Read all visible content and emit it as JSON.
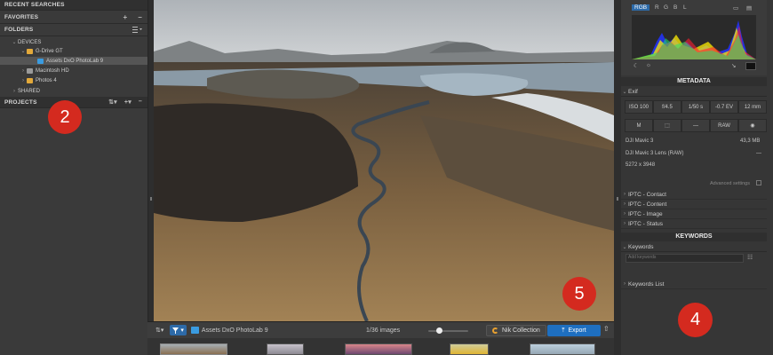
{
  "left_panel": {
    "recent_searches": "RECENT SEARCHES",
    "favorites": "FAVORITES",
    "folders": "FOLDERS",
    "devices": "DEVICES",
    "gdrive": "G-Drive GT",
    "assets": "Assets DxO PhotoLab 9",
    "macintosh": "Macintosh HD",
    "photos4": "Photos 4",
    "shared": "SHARED",
    "projects": "PROJECTS",
    "add_symbol": "+",
    "remove_symbol": "–"
  },
  "badges": {
    "b2": "2",
    "b4": "4",
    "b5": "5"
  },
  "toolbar": {
    "folder_name": "Assets DxO PhotoLab 9",
    "image_count": "1/36 images",
    "zoom_fraction": 0.2,
    "nik_label": "Nik Collection",
    "export_label": "Export"
  },
  "right_panel": {
    "channels": [
      "RGB",
      "R",
      "G",
      "B",
      "L"
    ],
    "metadata_title": "METADATA",
    "exif_label": "Exif",
    "exif_row1": [
      "ISO 100",
      "f/4.5",
      "1/50 s",
      "-0.7 EV",
      "12 mm"
    ],
    "exif_row2": [
      "M",
      "",
      "—",
      "RAW",
      ""
    ],
    "camera": "DJI Mavic 3",
    "file_size": "43,3 MB",
    "lens": "DJI Mavic 3 Lens (RAW)",
    "lens_value": "—",
    "dimensions": "5272 x 3948",
    "advanced_settings": "Advanced settings",
    "iptc": [
      "IPTC - Contact",
      "IPTC - Content",
      "IPTC - Image",
      "IPTC - Status"
    ],
    "keywords_title": "KEYWORDS",
    "keywords_label": "Keywords",
    "add_keywords_placeholder": "Add keywords",
    "keywords_list": "Keywords List"
  },
  "colors": {
    "accent": "#1e6fc0",
    "badge": "#d42a1f"
  }
}
